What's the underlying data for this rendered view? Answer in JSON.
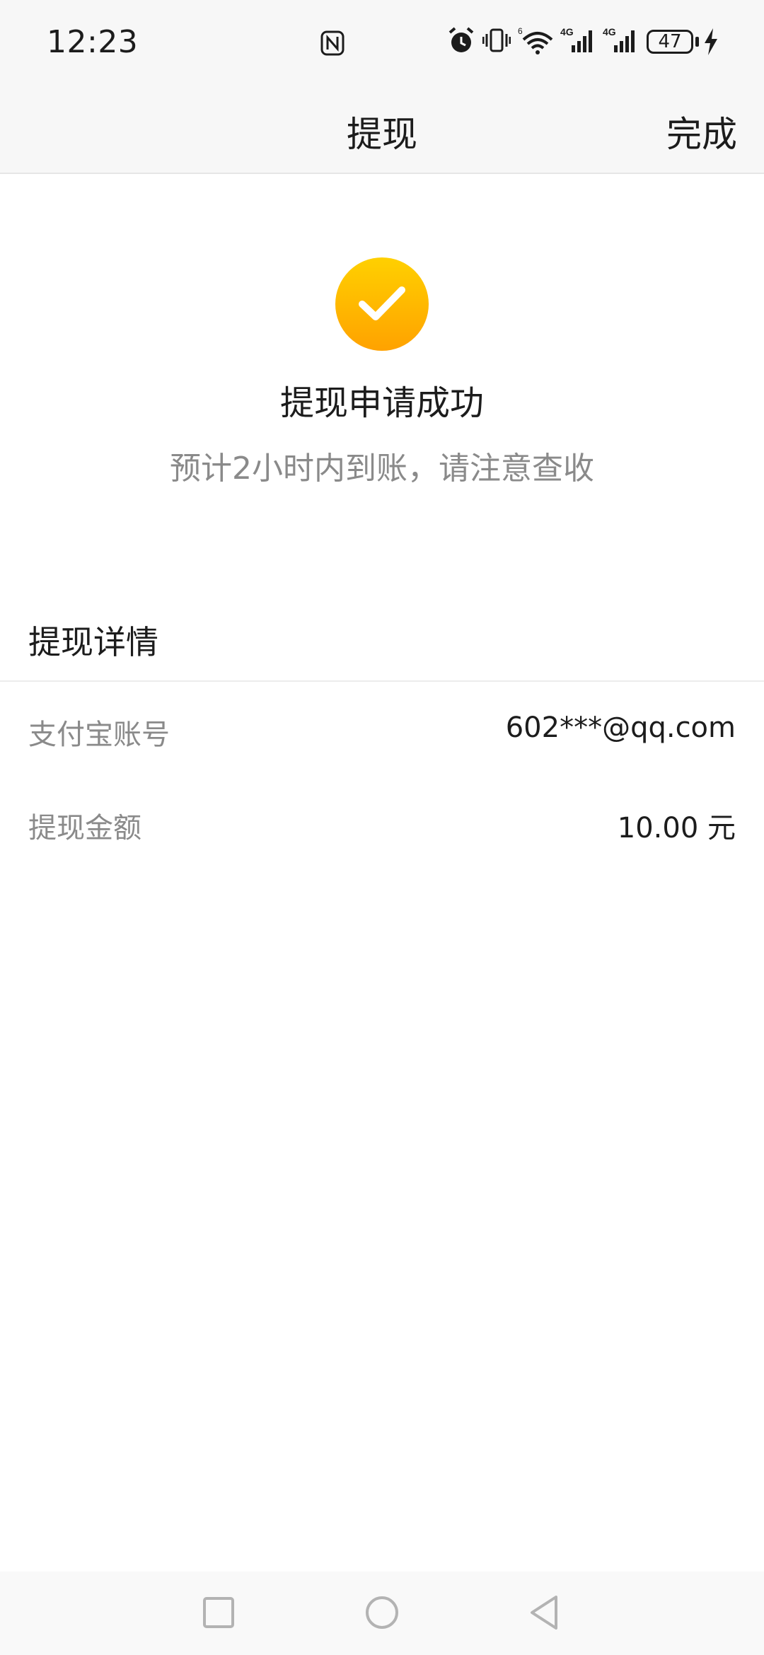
{
  "status_bar": {
    "time": "12:23",
    "battery_level": "47",
    "icons": [
      "nfc-icon",
      "alarm-icon",
      "vibrate-icon",
      "wifi-icon",
      "signal-4g-icon",
      "signal-4g-icon",
      "charging-icon"
    ]
  },
  "header": {
    "title": "提现",
    "done_label": "完成"
  },
  "success": {
    "icon": "check-circle-icon",
    "title": "提现申请成功",
    "subtitle": "预计2小时内到账，请注意查收"
  },
  "details": {
    "title": "提现详情",
    "rows": [
      {
        "label": "支付宝账号",
        "value": "602***@qq.com"
      },
      {
        "label": "提现金额",
        "value": "10.00 元"
      }
    ]
  },
  "nav": {
    "buttons": [
      "recent-apps-icon",
      "home-icon",
      "back-icon"
    ]
  },
  "colors": {
    "accent_start": "#ffd000",
    "accent_end": "#ffa200",
    "text_primary": "#1c1c1c",
    "text_secondary": "#8a8a8a"
  }
}
